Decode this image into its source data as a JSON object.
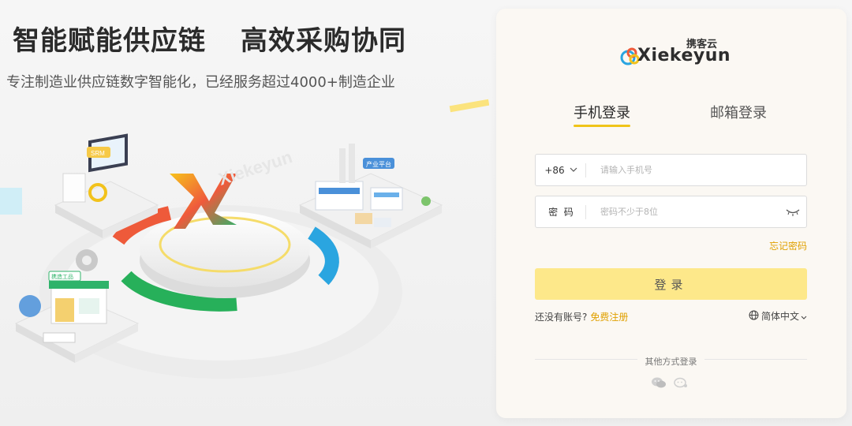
{
  "hero": {
    "title_part1": "智能赋能供应链",
    "title_part2": "高效采购协同",
    "subtitle": "专注制造业供应链数字智能化，已经服务超过4000+制造企业",
    "illustration_labels": {
      "srm": "SRM",
      "platform": "产业平台",
      "factory": "携造工品",
      "brand": "Xiekeyun"
    }
  },
  "logo": {
    "cn": "携客云",
    "en": "Xiekeyun"
  },
  "tabs": [
    {
      "label": "手机登录",
      "active": true
    },
    {
      "label": "邮箱登录",
      "active": false
    }
  ],
  "phone_field": {
    "prefix": "+86",
    "placeholder": "请输入手机号"
  },
  "password_field": {
    "label": "密  码",
    "placeholder": "密码不少于8位"
  },
  "forgot_password": "忘记密码",
  "login_button": "登录",
  "register": {
    "prompt": "还没有账号?",
    "link": "免费注册"
  },
  "language": "简体中文",
  "other_login": "其他方式登录",
  "colors": {
    "accent": "#f0c419",
    "link": "#e0a000",
    "button_bg": "#fde88a",
    "panel_bg": "#fbf8f3"
  },
  "icons": [
    "chevron-down-icon",
    "eye-closed-icon",
    "globe-icon",
    "wechat-icon",
    "enterprise-wechat-icon"
  ]
}
